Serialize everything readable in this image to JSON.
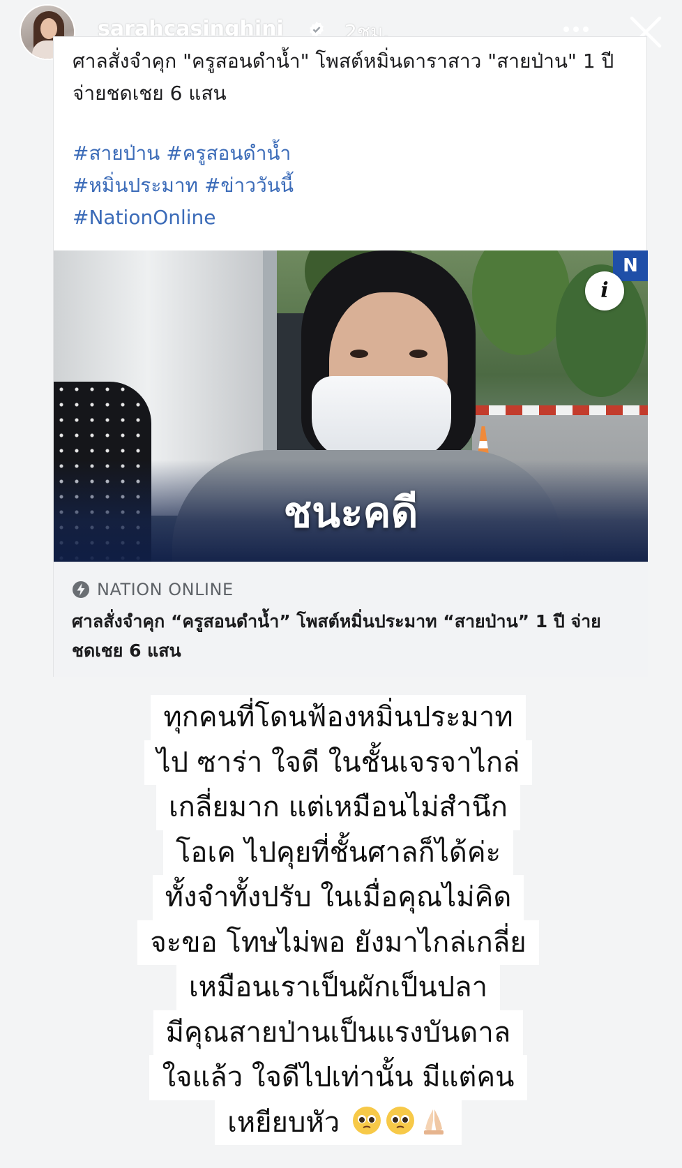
{
  "story": {
    "username": "sarahcasinghini",
    "time_ago": "2ชม."
  },
  "post": {
    "text": "ศาลสั่งจำคุก \"ครูสอนดำน้ำ\" โพสต์หมิ่นดาราสาว \"สายป่าน\" 1 ปี จ่ายชดเชย 6 แสน",
    "hashtags": [
      "#สายป่าน",
      "#ครูสอนดำน้ำ",
      "#หมิ่นประมาท",
      "#ข่าววันนี้",
      "#NationOnline"
    ],
    "image_caption": "ชนะคดี",
    "image_logo": "N",
    "info_icon": "i"
  },
  "link_preview": {
    "source": "NATION ONLINE",
    "title": "ศาลสั่งจำคุก “ครูสอนดำน้ำ” โพสต์หมิ่นประมาท “สายป่าน” 1 ปี จ่ายชดเชย 6 แสน"
  },
  "story_text": {
    "lines": [
      "ทุกคนที่โดนฟ้องหมิ่นประมาท",
      "ไป ซาร่า ใจดี ในชั้นเจรจาไกล่",
      "เกลี่ยมาก แต่เหมือนไม่สำนึก",
      "โอเค ไปคุยที่ชั้นศาลก็ได้ค่ะ",
      "ทั้งจำทั้งปรับ ในเมื่อคุณไม่คิด",
      "จะขอ โทษไม่พอ ยังมาไกล่เกลี่ย",
      "เหมือนเราเป็นผักเป็นปลา",
      "มีคุณสายป่านเป็นแรงบันดาล",
      "ใจแล้ว ใจดีไปเท่านั้น มีแต่คน",
      "เหยียบหัว"
    ],
    "emojis": [
      "pleading-face",
      "pleading-face",
      "folded-hands"
    ]
  },
  "icons": {
    "verified": "verified-badge-icon",
    "more": "more-options-icon",
    "close": "close-icon",
    "bolt": "bolt-icon"
  },
  "colors": {
    "hashtag": "#3b6bb8",
    "background": "#f3f4f5",
    "caption_band": "#1f3a78"
  }
}
